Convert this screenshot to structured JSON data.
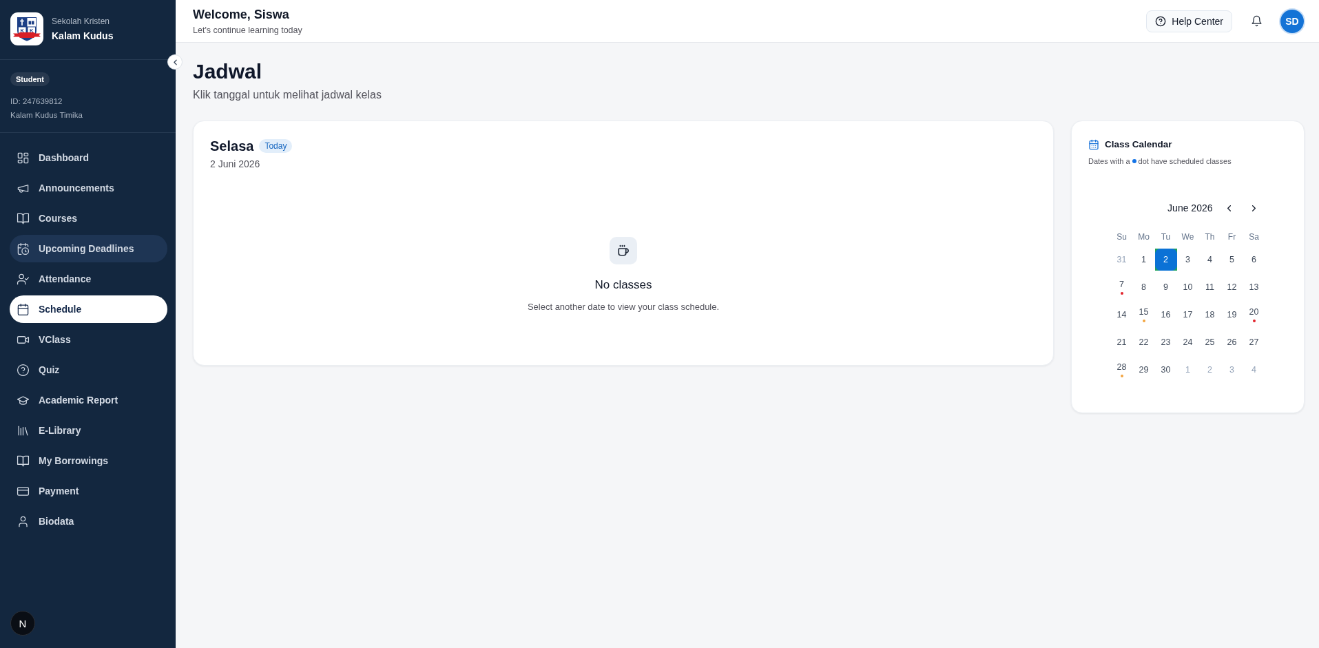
{
  "sidebar": {
    "school": {
      "subtitle": "Sekolah Kristen",
      "name": "Kalam Kudus",
      "logo_letters": [
        "K",
        "K"
      ]
    },
    "profile": {
      "role": "Student",
      "id": "ID: 247639812",
      "campus": "Kalam Kudus Timika"
    },
    "items": [
      {
        "label": "Dashboard",
        "selected": false,
        "hovered": false
      },
      {
        "label": "Announcements",
        "selected": false,
        "hovered": false
      },
      {
        "label": "Courses",
        "selected": false,
        "hovered": false
      },
      {
        "label": "Upcoming Deadlines",
        "selected": false,
        "hovered": true
      },
      {
        "label": "Attendance",
        "selected": false,
        "hovered": false
      },
      {
        "label": "Schedule",
        "selected": true,
        "hovered": false
      },
      {
        "label": "VClass",
        "selected": false,
        "hovered": false
      },
      {
        "label": "Quiz",
        "selected": false,
        "hovered": false
      },
      {
        "label": "Academic Report",
        "selected": false,
        "hovered": false
      },
      {
        "label": "E-Library",
        "selected": false,
        "hovered": false
      },
      {
        "label": "My Borrowings",
        "selected": false,
        "hovered": false
      },
      {
        "label": "Payment",
        "selected": false,
        "hovered": false
      },
      {
        "label": "Biodata",
        "selected": false,
        "hovered": false
      }
    ],
    "dev_badge": "N"
  },
  "header": {
    "title": "Welcome, Siswa",
    "subtitle": "Let's continue learning today",
    "help_button": "Help Center",
    "avatar": "SD"
  },
  "page": {
    "title": "Jadwal",
    "subtitle": "Klik tanggal untuk melihat jadwal kelas"
  },
  "schedule": {
    "day": "Selasa",
    "badge": "Today",
    "date": "2 Juni 2026",
    "empty_title": "No classes",
    "empty_text": "Select another date to view your class schedule."
  },
  "calendar": {
    "title": "Class Calendar",
    "hint_before": "Dates with a",
    "hint_after": "dot have scheduled classes",
    "month": "June 2026",
    "weekdays": [
      "Su",
      "Mo",
      "Tu",
      "We",
      "Th",
      "Fr",
      "Sa"
    ],
    "days": [
      {
        "label": "31",
        "outside": true,
        "selected": false
      },
      {
        "label": "1",
        "outside": false,
        "selected": false
      },
      {
        "label": "2",
        "outside": false,
        "selected": true
      },
      {
        "label": "3",
        "outside": false,
        "selected": false
      },
      {
        "label": "4",
        "outside": false,
        "selected": false
      },
      {
        "label": "5",
        "outside": false,
        "selected": false
      },
      {
        "label": "6",
        "outside": false,
        "selected": false
      },
      {
        "label": "7",
        "outside": false,
        "selected": false,
        "color": "#e2232b"
      },
      {
        "label": "8",
        "outside": false,
        "selected": false
      },
      {
        "label": "9",
        "outside": false,
        "selected": false
      },
      {
        "label": "10",
        "outside": false,
        "selected": false
      },
      {
        "label": "11",
        "outside": false,
        "selected": false
      },
      {
        "label": "12",
        "outside": false,
        "selected": false
      },
      {
        "label": "13",
        "outside": false,
        "selected": false
      },
      {
        "label": "14",
        "outside": false,
        "selected": false
      },
      {
        "label": "15",
        "outside": false,
        "selected": false,
        "color": "#f2a541"
      },
      {
        "label": "16",
        "outside": false,
        "selected": false
      },
      {
        "label": "17",
        "outside": false,
        "selected": false
      },
      {
        "label": "18",
        "outside": false,
        "selected": false
      },
      {
        "label": "19",
        "outside": false,
        "selected": false
      },
      {
        "label": "20",
        "outside": false,
        "selected": false,
        "color": "#e2232b"
      },
      {
        "label": "21",
        "outside": false,
        "selected": false
      },
      {
        "label": "22",
        "outside": false,
        "selected": false
      },
      {
        "label": "23",
        "outside": false,
        "selected": false
      },
      {
        "label": "24",
        "outside": false,
        "selected": false
      },
      {
        "label": "25",
        "outside": false,
        "selected": false
      },
      {
        "label": "26",
        "outside": false,
        "selected": false
      },
      {
        "label": "27",
        "outside": false,
        "selected": false
      },
      {
        "label": "28",
        "outside": false,
        "selected": false,
        "color": "#f2a541"
      },
      {
        "label": "29",
        "outside": false,
        "selected": false
      },
      {
        "label": "30",
        "outside": false,
        "selected": false
      },
      {
        "label": "1",
        "outside": true,
        "selected": false
      },
      {
        "label": "2",
        "outside": true,
        "selected": false
      },
      {
        "label": "3",
        "outside": true,
        "selected": false
      },
      {
        "label": "4",
        "outside": true,
        "selected": false
      }
    ]
  }
}
